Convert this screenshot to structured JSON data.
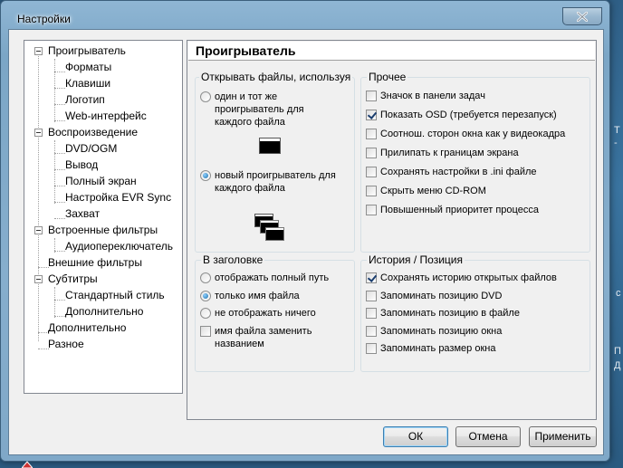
{
  "window": {
    "title": "Настройки"
  },
  "tree": {
    "items": [
      {
        "label": "Проигрыватель"
      },
      {
        "label": "Форматы"
      },
      {
        "label": "Клавиши"
      },
      {
        "label": "Логотип"
      },
      {
        "label": "Web-интерфейс"
      },
      {
        "label": "Воспроизведение"
      },
      {
        "label": "DVD/OGM"
      },
      {
        "label": "Вывод"
      },
      {
        "label": "Полный экран"
      },
      {
        "label": "Настройка EVR Sync"
      },
      {
        "label": "Захват"
      },
      {
        "label": "Встроенные фильтры"
      },
      {
        "label": "Аудиопереключатель"
      },
      {
        "label": "Внешние фильтры"
      },
      {
        "label": "Субтитры"
      },
      {
        "label": "Стандартный стиль"
      },
      {
        "label": "Дополнительно"
      },
      {
        "label": "Дополнительно"
      },
      {
        "label": "Разное"
      }
    ]
  },
  "panel": {
    "title": "Проигрыватель",
    "open_files": {
      "legend": "Открывать файлы, используя",
      "same_player": "один и тот же проигрыватель для каждого файла",
      "new_player": "новый проигрыватель для каждого файла"
    },
    "other": {
      "legend": "Прочее",
      "items": [
        {
          "label": "Значок в панели задач",
          "checked": false
        },
        {
          "label": "Показать OSD (требуется перезапуск)",
          "checked": true
        },
        {
          "label": "Соотнош. сторон окна как у видеокадра",
          "checked": false
        },
        {
          "label": "Прилипать к границам экрана",
          "checked": false
        },
        {
          "label": "Сохранять настройки в .ini файле",
          "checked": false
        },
        {
          "label": "Скрыть меню CD-ROM",
          "checked": false
        },
        {
          "label": "Повышенный приоритет процесса",
          "checked": false
        }
      ]
    },
    "title_bar": {
      "legend": "В заголовке",
      "full_path": "отображать полный путь",
      "file_name_only": "только имя файла",
      "show_nothing": "не отображать ничего",
      "replace_with_title": "имя файла заменить названием"
    },
    "history": {
      "legend": "История / Позиция",
      "items": [
        {
          "label": "Сохранять историю открытых файлов",
          "checked": true
        },
        {
          "label": "Запоминать позицию DVD",
          "checked": false
        },
        {
          "label": "Запоминать позицию в файле",
          "checked": false
        },
        {
          "label": "Запоминать позицию окна",
          "checked": false
        },
        {
          "label": "Запоминать размер окна",
          "checked": false
        }
      ]
    }
  },
  "buttons": {
    "ok": "ОК",
    "cancel": "Отмена",
    "apply": "Применить"
  },
  "icons": {
    "close": "close-icon",
    "single_window": "single-window-icon",
    "multi_window": "multi-window-icon",
    "expand": "collapse-icon"
  }
}
